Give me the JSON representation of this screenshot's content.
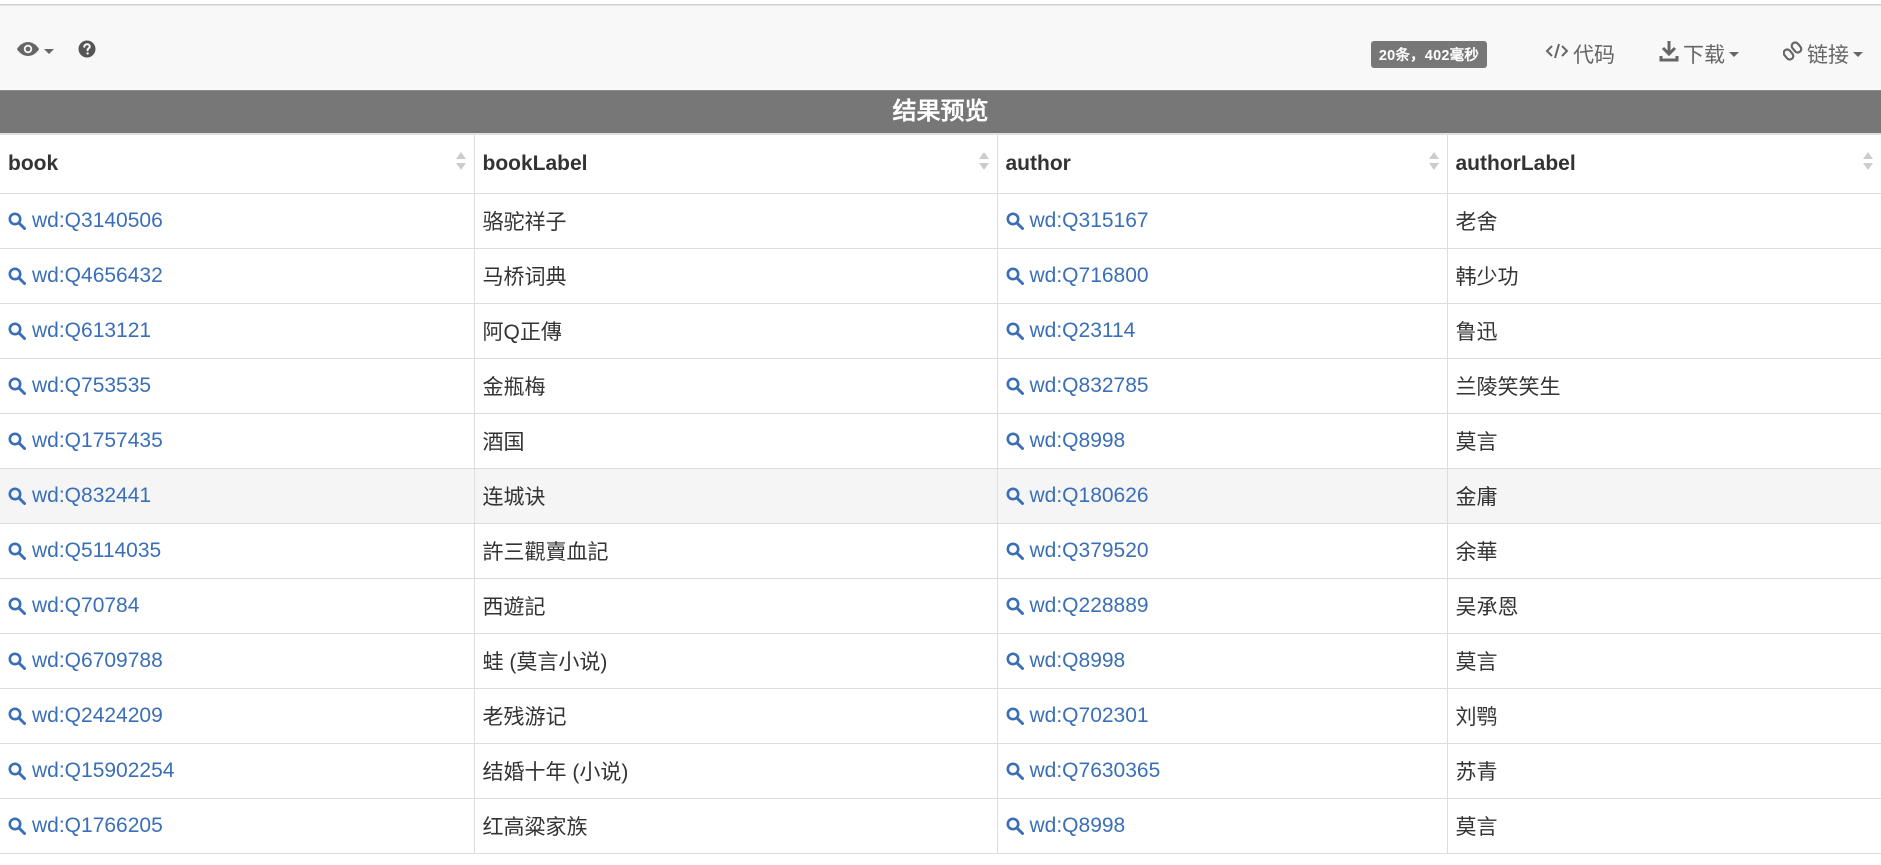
{
  "toolbar": {
    "left_icons": [
      "eye-icon",
      "question-circle-icon"
    ],
    "badge": "20条，402毫秒",
    "code_label": "代码",
    "download_label": "下载",
    "link_label": "链接"
  },
  "title": "结果预览",
  "columns": [
    "book",
    "bookLabel",
    "author",
    "authorLabel"
  ],
  "rows": [
    {
      "book": "wd:Q3140506",
      "bookLabel": "骆驼祥子",
      "author": "wd:Q315167",
      "authorLabel": "老舍"
    },
    {
      "book": "wd:Q4656432",
      "bookLabel": "马桥词典",
      "author": "wd:Q716800",
      "authorLabel": "韩少功"
    },
    {
      "book": "wd:Q613121",
      "bookLabel": "阿Q正傳",
      "author": "wd:Q23114",
      "authorLabel": "鲁迅"
    },
    {
      "book": "wd:Q753535",
      "bookLabel": "金瓶梅",
      "author": "wd:Q832785",
      "authorLabel": "兰陵笑笑生"
    },
    {
      "book": "wd:Q1757435",
      "bookLabel": "酒国",
      "author": "wd:Q8998",
      "authorLabel": "莫言"
    },
    {
      "book": "wd:Q832441",
      "bookLabel": "连城诀",
      "author": "wd:Q180626",
      "authorLabel": "金庸"
    },
    {
      "book": "wd:Q5114035",
      "bookLabel": "許三觀賣血記",
      "author": "wd:Q379520",
      "authorLabel": "余華"
    },
    {
      "book": "wd:Q70784",
      "bookLabel": "西遊記",
      "author": "wd:Q228889",
      "authorLabel": "吴承恩"
    },
    {
      "book": "wd:Q6709788",
      "bookLabel": "蛙 (莫言小说)",
      "author": "wd:Q8998",
      "authorLabel": "莫言"
    },
    {
      "book": "wd:Q2424209",
      "bookLabel": "老残游记",
      "author": "wd:Q702301",
      "authorLabel": "刘鹗"
    },
    {
      "book": "wd:Q15902254",
      "bookLabel": "结婚十年 (小说)",
      "author": "wd:Q7630365",
      "authorLabel": "苏青"
    },
    {
      "book": "wd:Q1766205",
      "bookLabel": "红高粱家族",
      "author": "wd:Q8998",
      "authorLabel": "莫言"
    }
  ],
  "colors": {
    "link": "#3a6fb7",
    "title_bar": "#777777",
    "badge": "#777777",
    "row_highlight": "#f5f5f5"
  }
}
